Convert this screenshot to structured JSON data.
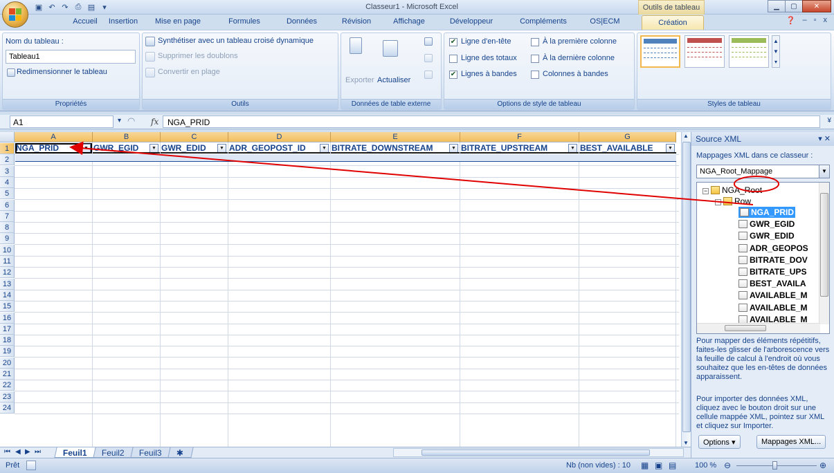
{
  "window": {
    "title": "Classeur1 - Microsoft Excel",
    "context_title": "Outils de tableau"
  },
  "tabs": [
    "Accueil",
    "Insertion",
    "Mise en page",
    "Formules",
    "Données",
    "Révision",
    "Affichage",
    "Développeur",
    "Compléments",
    "OS|ECM",
    "Création"
  ],
  "active_tab": "Création",
  "ribbon": {
    "properties": {
      "name_label": "Nom du tableau :",
      "name_value": "Tableau1",
      "resize": "Redimensionner le tableau",
      "group": "Propriétés"
    },
    "tools": {
      "pivot": "Synthétiser avec un tableau croisé dynamique",
      "dedupe": "Supprimer les doublons",
      "convert": "Convertir en plage",
      "group": "Outils"
    },
    "external": {
      "export": "Exporter",
      "refresh": "Actualiser",
      "group": "Données de table externe"
    },
    "style_options": {
      "header_row": "Ligne d'en-tête",
      "first_col": "À la première colonne",
      "total_row": "Ligne des totaux",
      "last_col": "À la dernière colonne",
      "banded_rows": "Lignes à bandes",
      "banded_cols": "Colonnes à bandes",
      "group": "Options de style de tableau",
      "checked": {
        "header_row": true,
        "first_col": false,
        "total_row": false,
        "last_col": false,
        "banded_rows": true,
        "banded_cols": false
      }
    },
    "styles": {
      "group": "Styles de tableau",
      "swatch_colors": [
        "#4f81bd",
        "#c0504d",
        "#9bbb59"
      ]
    }
  },
  "formula_bar": {
    "name_box": "A1",
    "fx": "fx",
    "value": "NGA_PRID"
  },
  "grid": {
    "columns": [
      "A",
      "B",
      "C",
      "D",
      "E",
      "F",
      "G"
    ],
    "headers": [
      "NGA_PRID",
      "GWR_EGID",
      "GWR_EDID",
      "ADR_GEOPOST_ID",
      "BITRATE_DOWNSTREAM",
      "BITRATE_UPSTREAM",
      "BEST_AVAILABLE"
    ],
    "rows": [
      "1",
      "2",
      "3",
      "4",
      "5",
      "6",
      "7",
      "8",
      "9",
      "10",
      "11",
      "12",
      "13",
      "14",
      "15",
      "16",
      "17",
      "18",
      "19",
      "20",
      "21",
      "22",
      "23",
      "24"
    ]
  },
  "sheets": [
    "Feuil1",
    "Feuil2",
    "Feuil3"
  ],
  "active_sheet": "Feuil1",
  "status": {
    "ready": "Prêt",
    "count": "Nb (non vides) : 10",
    "zoom": "100 %"
  },
  "xml_pane": {
    "title": "Source XML",
    "maps_label": "Mappages XML dans ce classeur :",
    "map_value": "NGA_Root_Mappage",
    "tree": {
      "root": "NGA_Root",
      "row": "Row",
      "items": [
        "NGA_PRID",
        "GWR_EGID",
        "GWR_EDID",
        "ADR_GEOPOS",
        "BITRATE_DOV",
        "BITRATE_UPS",
        "BEST_AVAILA",
        "AVAILABLE_M",
        "AVAILABLE_M",
        "AVAILABLE_M"
      ]
    },
    "help1": "Pour mapper des éléments répétitifs, faites-les glisser de l'arborescence vers la feuille de calcul à l'endroit où vous souhaitez que les en-têtes de données apparaissent.",
    "help2": "Pour importer des données XML, cliquez avec le bouton droit sur une cellule mappée XML, pointez sur XML et cliquez sur Importer.",
    "options_btn": "Options ▾",
    "maps_btn": "Mappages XML..."
  }
}
